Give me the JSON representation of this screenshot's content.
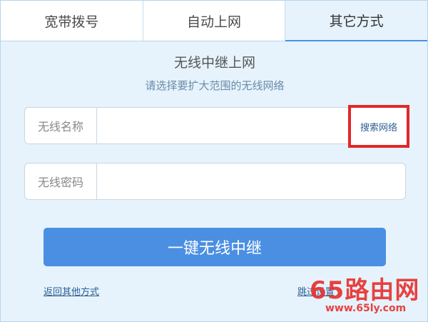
{
  "tabs": [
    {
      "label": "宽带拨号",
      "active": false
    },
    {
      "label": "自动上网",
      "active": false
    },
    {
      "label": "其它方式",
      "active": true
    }
  ],
  "main": {
    "title": "无线中继上网",
    "subtitle": "请选择要扩大范围的无线网络",
    "ssid_label": "无线名称",
    "ssid_value": "",
    "search_label": "搜索网络",
    "password_label": "无线密码",
    "password_value": "",
    "submit_label": "一键无线中继",
    "back_link": "返回其他方式",
    "skip_link": "跳过设置"
  },
  "watermark": {
    "brand": "65路由网",
    "url": "www.65ly.com"
  },
  "colors": {
    "accent": "#4b8fe2",
    "background": "#e6f3fc",
    "highlight_box": "#e02828",
    "watermark": "#e8322f"
  }
}
